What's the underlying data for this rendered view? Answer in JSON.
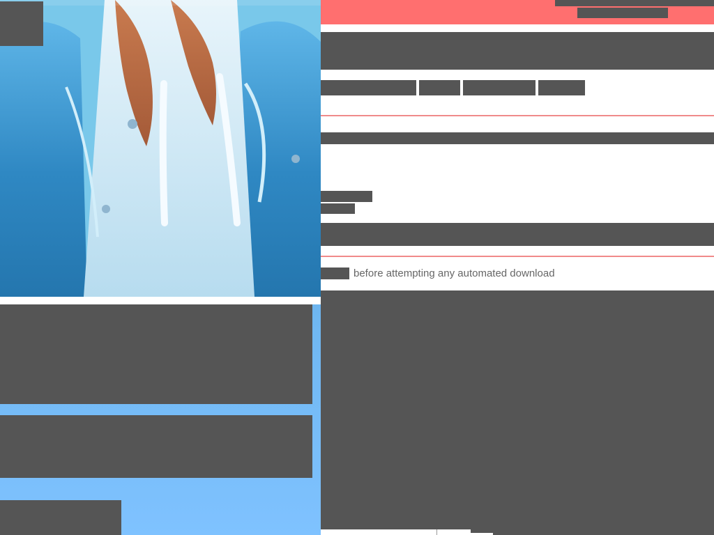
{
  "colors": {
    "accent": "#ff6f6f",
    "divider": "#f08a8a",
    "placeholder_block": "#555555",
    "notice_text": "#666666",
    "hero_gradient_top": "#4ea5d9",
    "hero_gradient_bottom": "#7fc2ff"
  },
  "icons": {
    "logo": "logo-placeholder-icon"
  },
  "notice": {
    "text": "before attempting any automated download"
  }
}
